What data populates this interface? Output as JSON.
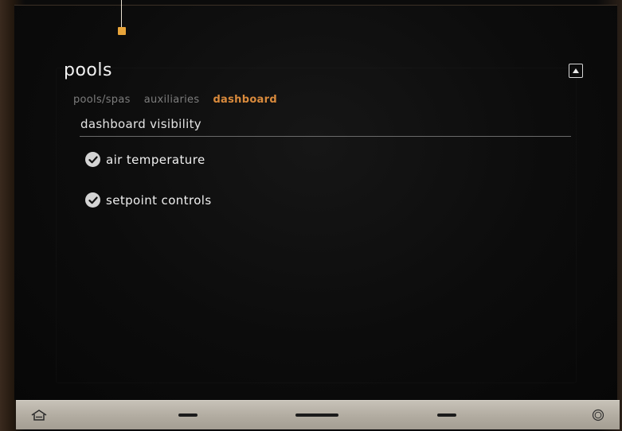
{
  "header": {
    "title": "pools"
  },
  "tabs": [
    {
      "label": "pools/spas",
      "active": false
    },
    {
      "label": "auxiliaries",
      "active": false
    },
    {
      "label": "dashboard",
      "active": true
    }
  ],
  "section": {
    "title": "dashboard visibility",
    "options": [
      {
        "label": "air temperature",
        "checked": true
      },
      {
        "label": "setpoint controls",
        "checked": true
      }
    ]
  },
  "icons": {
    "collapse": "collapse-up-icon",
    "check": "check-circle-icon",
    "home": "home-icon",
    "settings": "circle-icon"
  },
  "colors": {
    "accent": "#d98a3c",
    "pointer": "#e8a43a",
    "background": "#0c0c0c",
    "navbar": "#b3ada2"
  }
}
